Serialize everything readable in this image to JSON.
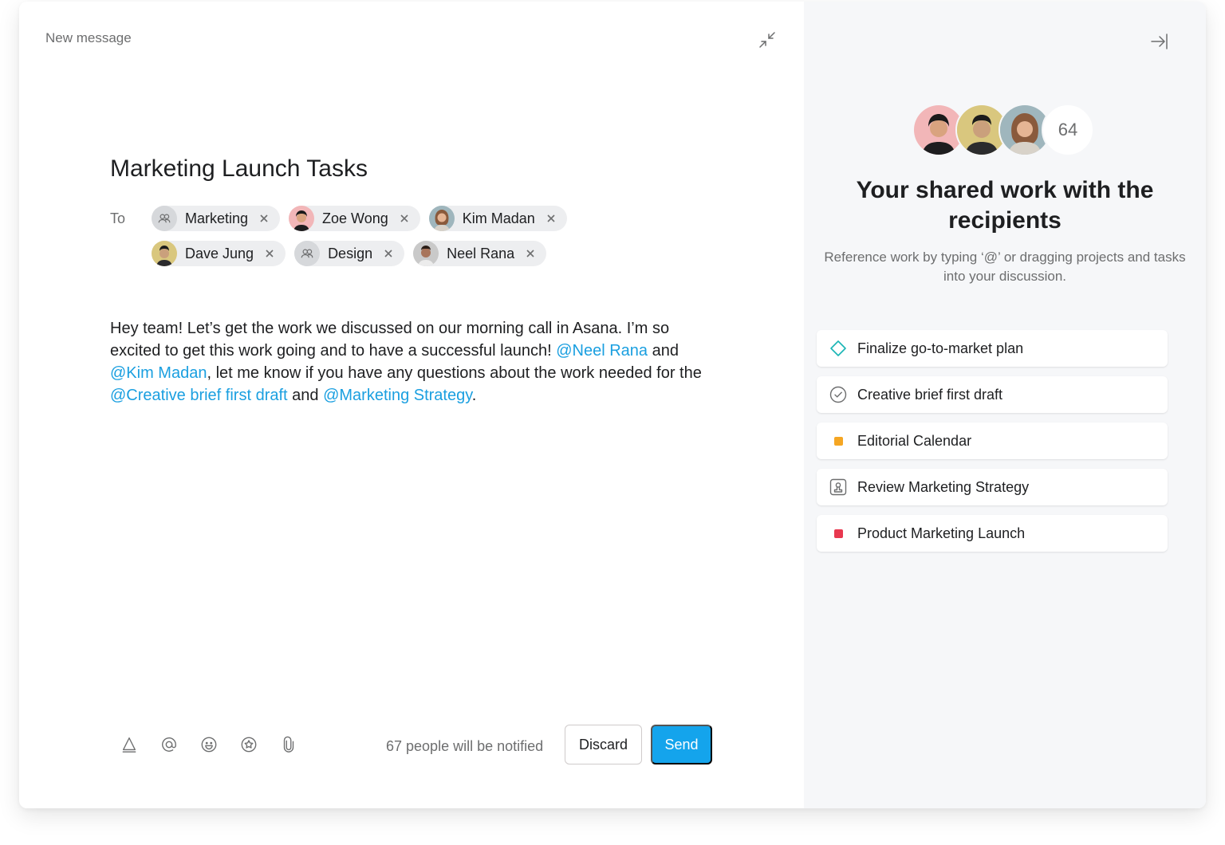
{
  "compose": {
    "window_label": "New message",
    "subject": "Marketing Launch Tasks",
    "to_label": "To",
    "recipients": [
      {
        "name": "Marketing",
        "kind": "team"
      },
      {
        "name": "Zoe Wong",
        "kind": "person"
      },
      {
        "name": "Kim Madan",
        "kind": "person"
      },
      {
        "name": "Dave Jung",
        "kind": "person"
      },
      {
        "name": "Design",
        "kind": "team"
      },
      {
        "name": "Neel Rana",
        "kind": "person"
      }
    ],
    "body": {
      "text1": "Hey team! Let’s get the work we discussed on our morning call in Asana. I’m so excited to get this work going and to have a successful launch! ",
      "mention1": "@Neel Rana",
      "text2": " and ",
      "mention2": "@Kim Madan",
      "text3": ", let me know if you have any questions about the work needed for the ",
      "mention3": "@Creative brief first draft",
      "text4": " and ",
      "mention4": "@Marketing Strategy",
      "text5": "."
    },
    "toolbar_icons": [
      "text-format-icon",
      "mention-icon",
      "emoji-icon",
      "star-icon",
      "attachment-icon"
    ],
    "notify_text": "67 people will be notified",
    "discard_label": "Discard",
    "send_label": "Send"
  },
  "shared_panel": {
    "avatar_count": "64",
    "title": "Your shared work with the recipients",
    "subtitle": "Reference work by typing ‘@’ or dragging projects and tasks into your discussion.",
    "items": [
      {
        "label": "Finalize go-to-market plan",
        "icon": "milestone-icon"
      },
      {
        "label": "Creative brief first draft",
        "icon": "task-check-icon"
      },
      {
        "label": "Editorial Calendar",
        "icon": "project-color-square",
        "color": "#f5a623"
      },
      {
        "label": "Review Marketing Strategy",
        "icon": "approval-icon"
      },
      {
        "label": "Product Marketing Launch",
        "icon": "project-color-square",
        "color": "#e8384f"
      }
    ]
  },
  "colors": {
    "accent": "#14a4ec",
    "mention": "#1a9fe0",
    "milestone": "#19b5b5"
  }
}
